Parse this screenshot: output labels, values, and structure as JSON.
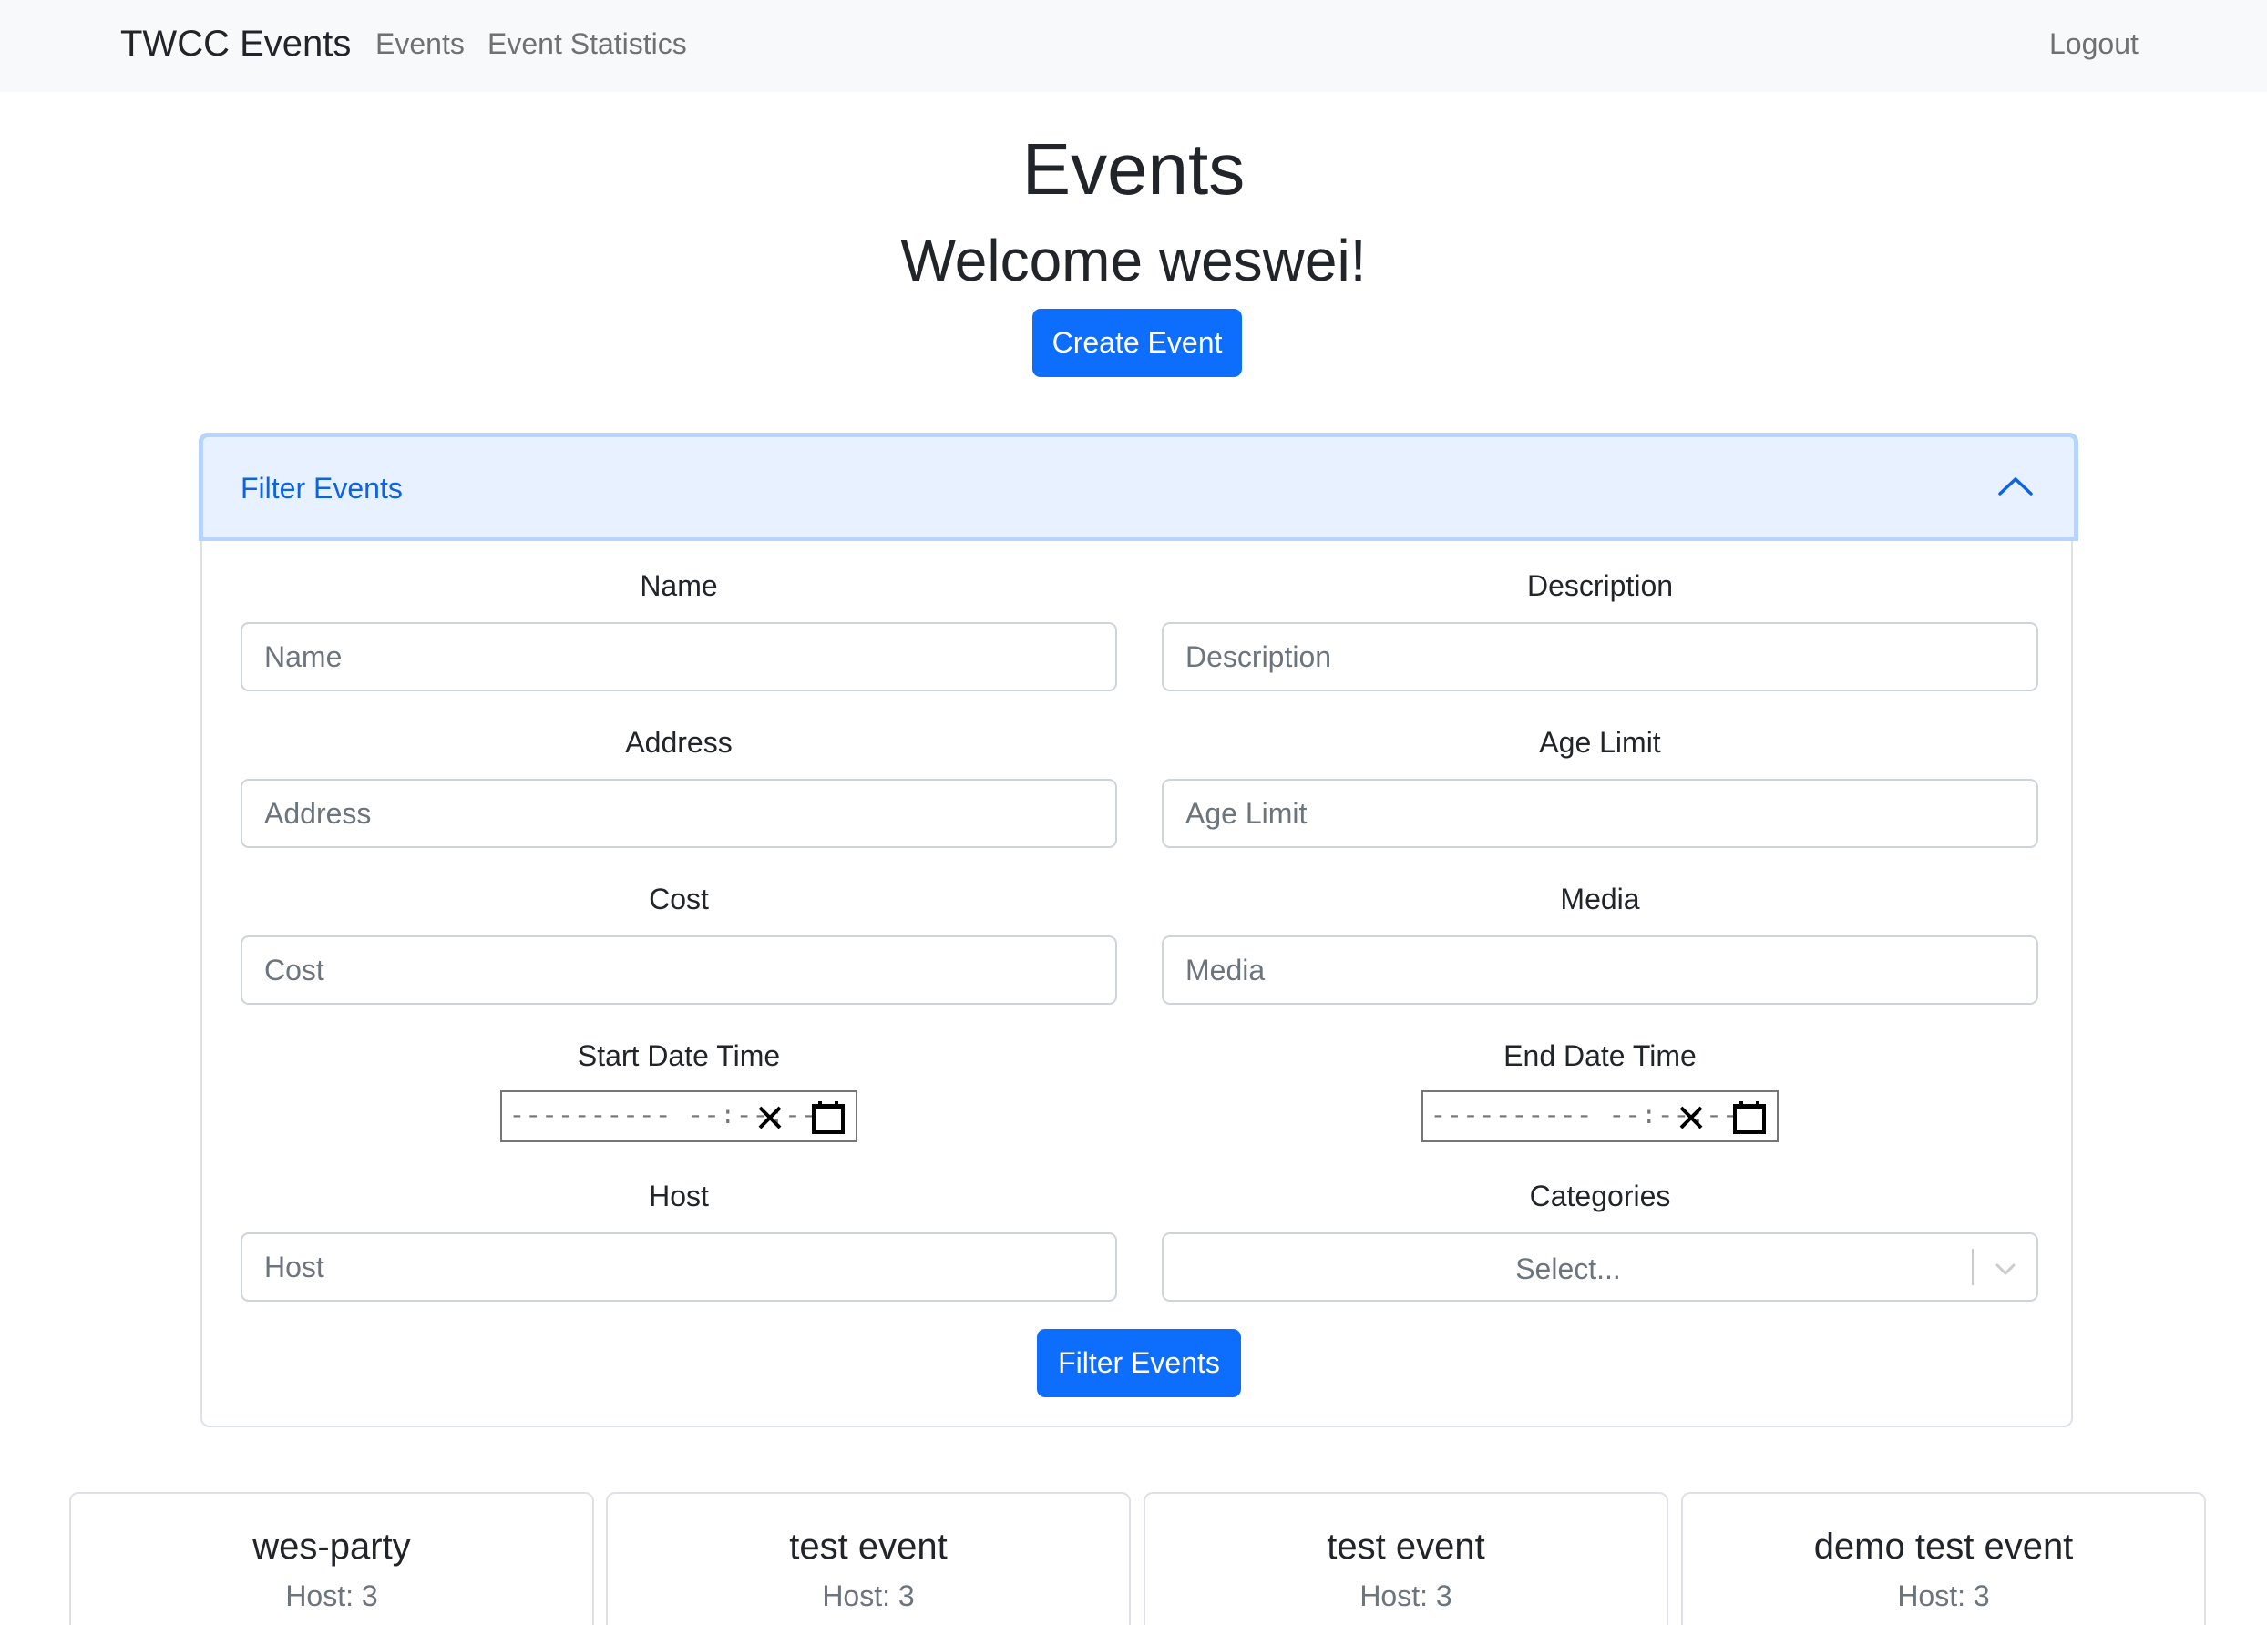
{
  "navbar": {
    "brand": "TWCC Events",
    "links": [
      "Events",
      "Event Statistics"
    ],
    "logout": "Logout"
  },
  "header": {
    "title": "Events",
    "welcome": "Welcome weswei!",
    "create_button": "Create Event"
  },
  "filter": {
    "title": "Filter Events",
    "expanded": true,
    "fields": {
      "name": {
        "label": "Name",
        "placeholder": "Name"
      },
      "description": {
        "label": "Description",
        "placeholder": "Description"
      },
      "address": {
        "label": "Address",
        "placeholder": "Address"
      },
      "age_limit": {
        "label": "Age Limit",
        "placeholder": "Age Limit"
      },
      "cost": {
        "label": "Cost",
        "placeholder": "Cost"
      },
      "media": {
        "label": "Media",
        "placeholder": "Media"
      },
      "start": {
        "label": "Start Date Time",
        "placeholder": "---------- --:--:--"
      },
      "end": {
        "label": "End Date Time",
        "placeholder": "---------- --:--:--"
      },
      "host": {
        "label": "Host",
        "placeholder": "Host"
      },
      "categories": {
        "label": "Categories",
        "placeholder": "Select..."
      }
    },
    "submit": "Filter Events"
  },
  "events": [
    {
      "name": "wes-party",
      "host": "Host: 3"
    },
    {
      "name": "test event",
      "host": "Host: 3"
    },
    {
      "name": "test event",
      "host": "Host: 3"
    },
    {
      "name": "demo test event",
      "host": "Host: 3"
    }
  ],
  "colors": {
    "primary": "#0d6efd",
    "accordion_header_bg": "#e7f1ff",
    "accordion_header_text": "#0c63e4",
    "navbar_bg": "#f8f9fa"
  }
}
